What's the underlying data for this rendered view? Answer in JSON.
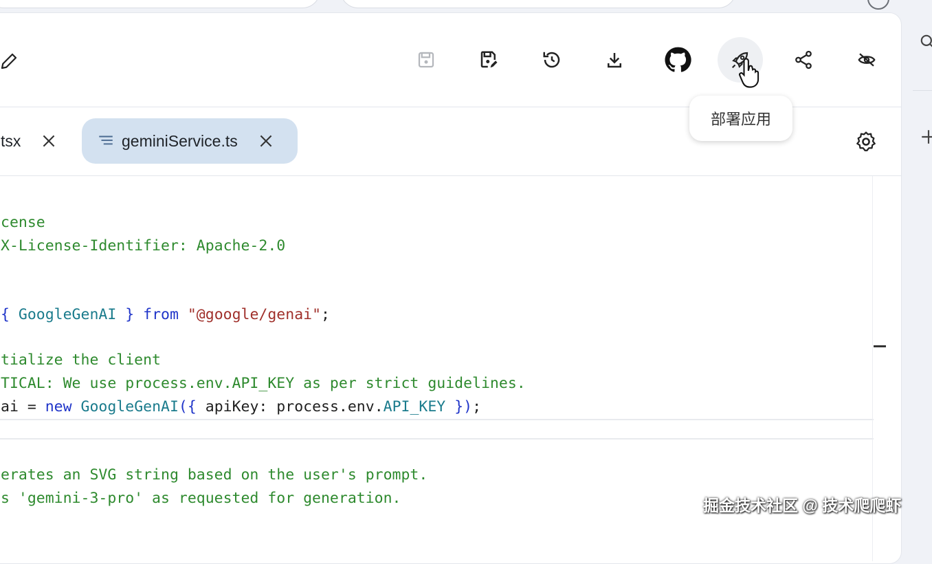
{
  "toolbar": {
    "buttons": [
      {
        "name": "save",
        "icon": "save-icon"
      },
      {
        "name": "save-as",
        "icon": "save-edit-icon"
      },
      {
        "name": "history",
        "icon": "history-icon"
      },
      {
        "name": "download",
        "icon": "download-icon"
      },
      {
        "name": "github",
        "icon": "github-icon"
      },
      {
        "name": "deploy",
        "icon": "rocket-icon"
      },
      {
        "name": "share",
        "icon": "share-icon"
      },
      {
        "name": "hide",
        "icon": "visibility-off-icon"
      }
    ],
    "tooltip": "部署应用"
  },
  "tabs": {
    "first_label": "tsx",
    "active_label": "geminiService.ts"
  },
  "code": {
    "lines": [
      {
        "parts": [
          {
            "t": "cense",
            "c": "c-green"
          }
        ]
      },
      {
        "parts": [
          {
            "t": "X-License-Identifier: Apache-2.0",
            "c": "c-green"
          }
        ]
      },
      {
        "parts": [
          {
            "t": "{ ",
            "c": "c-blue"
          },
          {
            "t": "GoogleGenAI",
            "c": "c-teal"
          },
          {
            "t": " } ",
            "c": "c-blue"
          },
          {
            "t": "from",
            "c": "c-blue"
          },
          {
            "t": " "
          },
          {
            "t": "\"@google/genai\"",
            "c": "c-str"
          },
          {
            "t": ";"
          }
        ]
      },
      {
        "parts": [
          {
            "t": "tialize the client",
            "c": "c-green"
          }
        ]
      },
      {
        "parts": [
          {
            "t": "TICAL: We use process.env.API_KEY as per strict guidelines.",
            "c": "c-green"
          }
        ]
      },
      {
        "parts": [
          {
            "t": "ai = "
          },
          {
            "t": "new",
            "c": "c-blue"
          },
          {
            "t": " "
          },
          {
            "t": "GoogleGenAI",
            "c": "c-teal"
          },
          {
            "t": "({",
            "c": "c-blue"
          },
          {
            "t": " apiKey: process.env."
          },
          {
            "t": "API_KEY",
            "c": "c-teal"
          },
          {
            "t": " })",
            "c": "c-blue"
          },
          {
            "t": ";"
          }
        ]
      },
      {
        "parts": [
          {
            "t": "erates an SVG string based on the user's prompt.",
            "c": "c-green"
          }
        ]
      },
      {
        "parts": [
          {
            "t": "s 'gemini-3-pro' as requested for generation.",
            "c": "c-green"
          }
        ]
      }
    ]
  },
  "sidebar": {
    "search_icon": "search-icon",
    "add_icon": "plus-icon"
  },
  "watermark": "掘金技术社区 @ 技术爬爬虾",
  "colors": {
    "active_tab_bg": "#d3e1f0",
    "comment_green": "#2e8a2e",
    "keyword_blue": "#2035c9",
    "type_teal": "#1a7b8c",
    "string_red": "#a0302b"
  }
}
